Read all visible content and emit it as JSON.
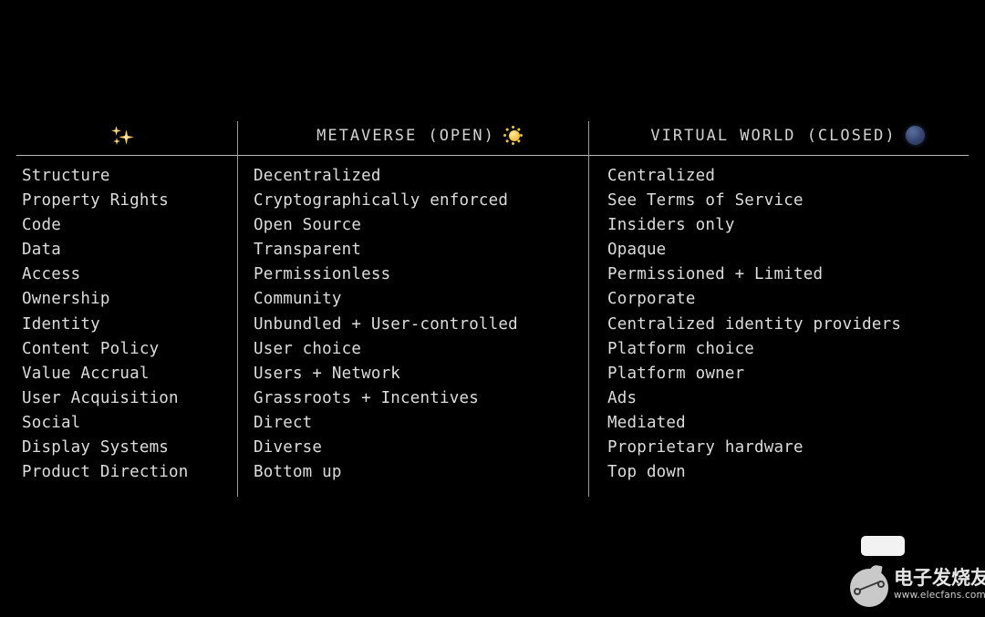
{
  "slide": {
    "background_color": "#000000",
    "text_color": "#dcdcdc",
    "rule_color": "#b9b9b9"
  },
  "table": {
    "headers": [
      {
        "label": "",
        "icon": "sparkles-icon",
        "icon_color": "#f6c653"
      },
      {
        "label": "METAVERSE (OPEN)",
        "icon": "sun-icon",
        "icon_color": "#f4c542"
      },
      {
        "label": "VIRTUAL WORLD (CLOSED)",
        "icon": "blue-planet-icon",
        "icon_color": "#3b4a75"
      }
    ],
    "rows": [
      {
        "attribute": "Structure",
        "metaverse": "Decentralized",
        "virtual_world": "Centralized"
      },
      {
        "attribute": "Property Rights",
        "metaverse": "Cryptographically enforced",
        "virtual_world": "See Terms of Service"
      },
      {
        "attribute": "Code",
        "metaverse": "Open Source",
        "virtual_world": "Insiders only"
      },
      {
        "attribute": "Data",
        "metaverse": "Transparent",
        "virtual_world": "Opaque"
      },
      {
        "attribute": "Access",
        "metaverse": "Permissionless",
        "virtual_world": "Permissioned + Limited"
      },
      {
        "attribute": "Ownership",
        "metaverse": "Community",
        "virtual_world": "Corporate"
      },
      {
        "attribute": "Identity",
        "metaverse": "Unbundled + User-controlled",
        "virtual_world": "Centralized identity providers"
      },
      {
        "attribute": "Content Policy",
        "metaverse": "User choice",
        "virtual_world": "Platform choice"
      },
      {
        "attribute": "Value Accrual",
        "metaverse": "Users + Network",
        "virtual_world": "Platform owner"
      },
      {
        "attribute": "User Acquisition",
        "metaverse": "Grassroots + Incentives",
        "virtual_world": "Ads"
      },
      {
        "attribute": "Social",
        "metaverse": "Direct",
        "virtual_world": "Mediated"
      },
      {
        "attribute": "Display Systems",
        "metaverse": "Diverse",
        "virtual_world": "Proprietary hardware"
      },
      {
        "attribute": "Product Direction",
        "metaverse": "Bottom up",
        "virtual_world": "Top down"
      }
    ]
  },
  "watermark": {
    "name": "电子发烧友",
    "url": "www.elecfans.com"
  }
}
